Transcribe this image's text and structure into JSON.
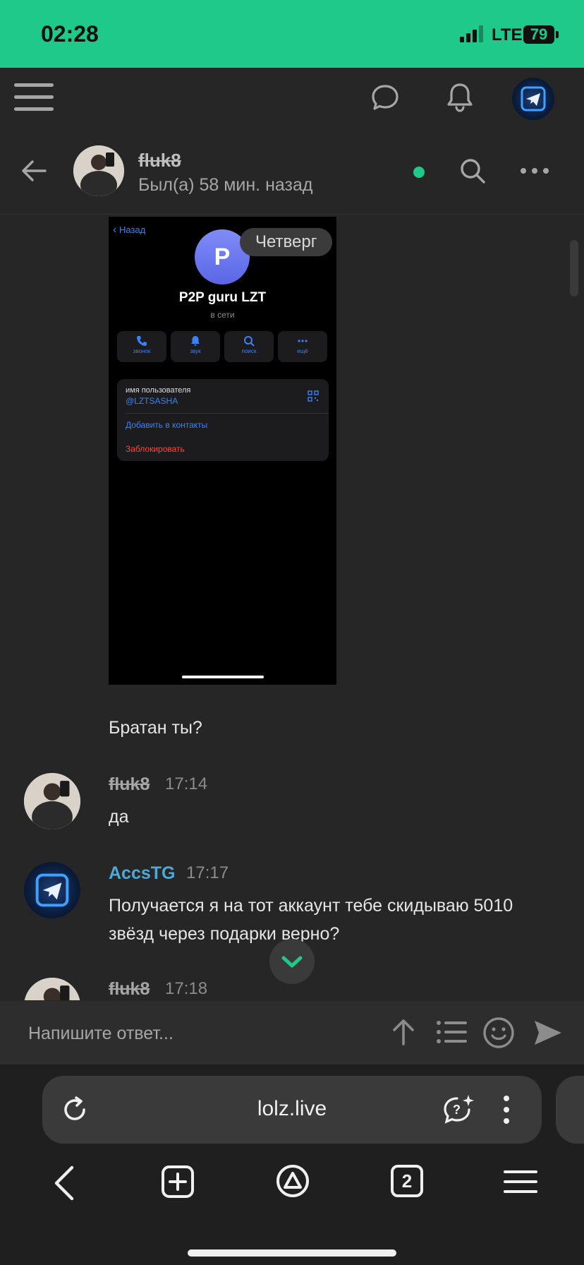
{
  "status_bar": {
    "time": "02:28",
    "network": "LTE",
    "battery": "79"
  },
  "chat_header": {
    "peer_name": "fluk8",
    "peer_status": "Был(а) 58 мин. назад"
  },
  "shared_screenshot": {
    "back_label": "Назад",
    "avatar_letter": "P",
    "title": "P2P guru LZT",
    "subtitle": "в сети",
    "actions": [
      {
        "label": "звонок",
        "icon": "phone-icon"
      },
      {
        "label": "звук",
        "icon": "bell-icon"
      },
      {
        "label": "поиск",
        "icon": "search-icon"
      },
      {
        "label": "ещё",
        "icon": "more-icon"
      }
    ],
    "username_label": "имя пользователя",
    "username": "@LZTSASHA",
    "add_contact": "Добавить в контакты",
    "block": "Заблокировать"
  },
  "day_separator": "Четверг",
  "messages": [
    {
      "text": "Братан ты?"
    },
    {
      "author": "fluk8",
      "time": "17:14",
      "text": "да"
    },
    {
      "author": "AccsTG",
      "time": "17:17",
      "text_line1": "Получается я на тот аккаунт тебе скидываю 5010",
      "text_line2": "звёзд через подарки верно?"
    },
    {
      "author": "fluk8",
      "time": "17:18"
    }
  ],
  "composer": {
    "placeholder": "Напишите ответ..."
  },
  "browser": {
    "url": "lolz.live",
    "tab_count": "2"
  },
  "colors": {
    "accent": "#1ec98a",
    "link": "#4ea9d8",
    "background": "#262626"
  }
}
